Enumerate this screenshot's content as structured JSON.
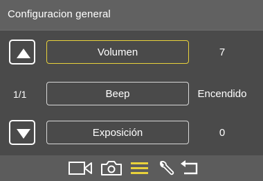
{
  "header": {
    "title": "Configuracion general"
  },
  "nav": {
    "up_icon": "arrow-up-icon",
    "down_icon": "arrow-down-icon",
    "page_indicator": "1/1"
  },
  "menu": {
    "items": [
      {
        "label": "Volumen",
        "value": "7",
        "selected": true
      },
      {
        "label": "Beep",
        "value": "Encendido",
        "selected": false
      },
      {
        "label": "Exposición",
        "value": "0",
        "selected": false
      }
    ]
  },
  "bottom_bar": {
    "icons": [
      "video-camera-icon",
      "photo-camera-icon",
      "menu-icon",
      "wrench-icon",
      "back-arrow-icon"
    ],
    "active_icon": "menu-icon"
  },
  "colors": {
    "accent": "#e9d23b",
    "background": "#4a4a4a",
    "header": "#616161",
    "bar": "#5c5c5c"
  }
}
